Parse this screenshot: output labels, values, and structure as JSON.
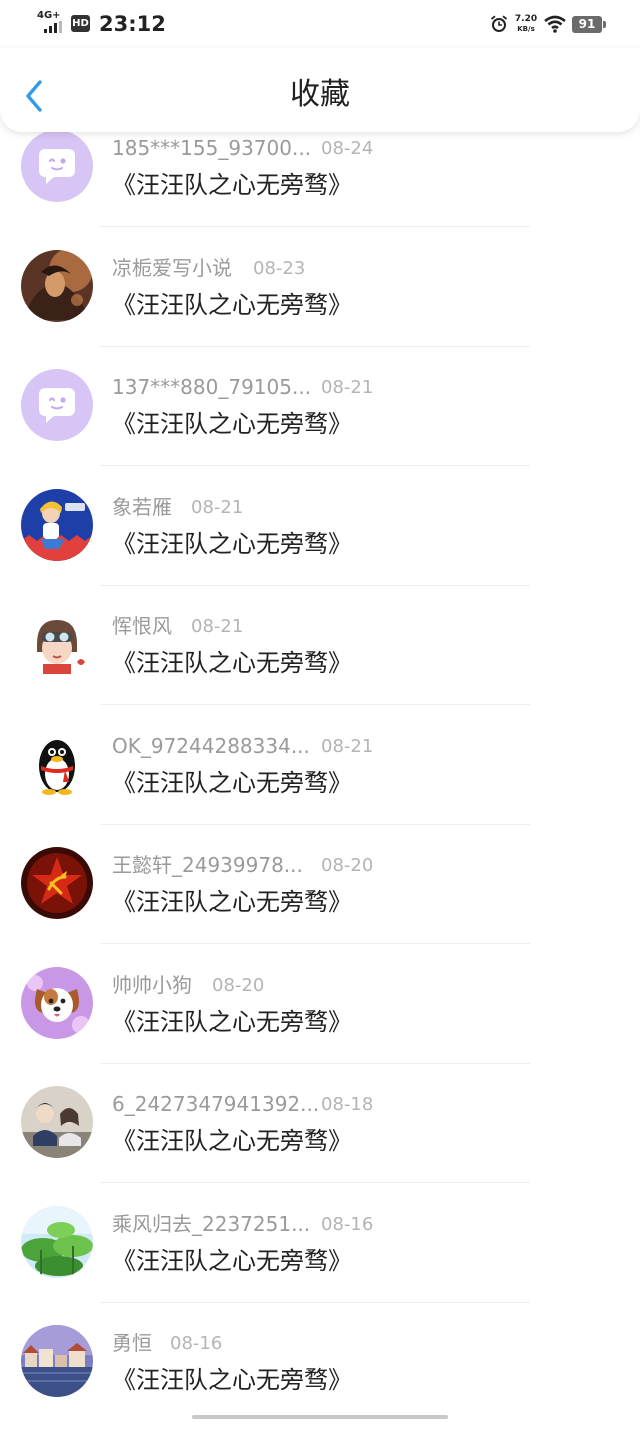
{
  "status_bar": {
    "network": "4G+",
    "hd": "HD",
    "time": "23:12",
    "speed_value": "7.20",
    "speed_unit": "KB/s",
    "battery": "91"
  },
  "header": {
    "title": "收藏",
    "back_icon": "chevron-left-icon",
    "accent_color": "#2f9bea"
  },
  "items": [
    {
      "user": "185***155_93700...",
      "date": "08-24",
      "title": "《汪汪队之心无旁骛》",
      "avatar": "default-chat-avatar"
    },
    {
      "user": "凉栀爱写小说",
      "date": "08-23",
      "title": "《汪汪队之心无旁骛》",
      "avatar": "illustration-avatar"
    },
    {
      "user": "137***880_79105...",
      "date": "08-21",
      "title": "《汪汪队之心无旁骛》",
      "avatar": "default-chat-avatar"
    },
    {
      "user": "象若雁",
      "date": "08-21",
      "title": "《汪汪队之心无旁骛》",
      "avatar": "cartoon-girl-avatar"
    },
    {
      "user": "恽恨风",
      "date": "08-21",
      "title": "《汪汪队之心无旁骛》",
      "avatar": "cartoon-pilot-avatar"
    },
    {
      "user": "OK_97244288334...",
      "date": "08-21",
      "title": "《汪汪队之心无旁骛》",
      "avatar": "penguin-avatar"
    },
    {
      "user": "王懿轩_24939978...",
      "date": "08-20",
      "title": "《汪汪队之心无旁骛》",
      "avatar": "red-star-avatar"
    },
    {
      "user": "帅帅小狗",
      "date": "08-20",
      "title": "《汪汪队之心无旁骛》",
      "avatar": "puppy-avatar"
    },
    {
      "user": "6_2427347941392...",
      "date": "08-18",
      "title": "《汪汪队之心无旁骛》",
      "avatar": "photo-people-avatar"
    },
    {
      "user": "乘风归去_2237251...",
      "date": "08-16",
      "title": "《汪汪队之心无旁骛》",
      "avatar": "lotus-leaf-avatar"
    },
    {
      "user": "勇恒",
      "date": "08-16",
      "title": "《汪汪队之心无旁骛》",
      "avatar": "town-scene-avatar"
    }
  ]
}
